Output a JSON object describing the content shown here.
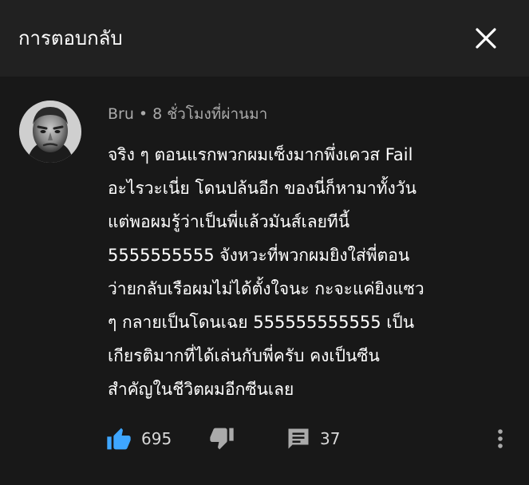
{
  "header": {
    "title": "การตอบกลับ"
  },
  "comment": {
    "author": "Bru",
    "separator": "•",
    "time": "8 ชั่วโมงที่ผ่านมา",
    "lines": [
      "จริง ๆ ตอนแรกพวกผมเซ็งมากพึ่งเควส Fail",
      "อะไรวะเนี่ย โดนปล้นอีก ของนี่ก็หามาทั้งวัน",
      "แต่พอผมรู้ว่าเป็นพี่แล้วมันส์เลยทีนี้",
      "5555555555 จังหวะที่พวกผมยิงใส่พี่ตอน",
      "ว่ายกลับเรือผมไม่ได้ตั้งใจนะ กะจะแค่ยิงแซว",
      "ๆ กลายเป็นโดนเฉย 555555555555 เป็น",
      "เกียรติมากที่ได้เล่นกับพี่ครับ คงเป็นซีน",
      "สำคัญในชีวิตผมอีกซีนเลย"
    ],
    "likes": "695",
    "replies": "37"
  },
  "colors": {
    "header_bg": "#212121",
    "comment_bg": "#181818",
    "like_active": "#3ea6ff",
    "meta_text": "#aaaaaa"
  },
  "icons": {
    "close": "close-icon",
    "like": "thumbs-up-icon",
    "dislike": "thumbs-down-icon",
    "reply": "comment-icon",
    "menu": "more-vert-icon"
  }
}
